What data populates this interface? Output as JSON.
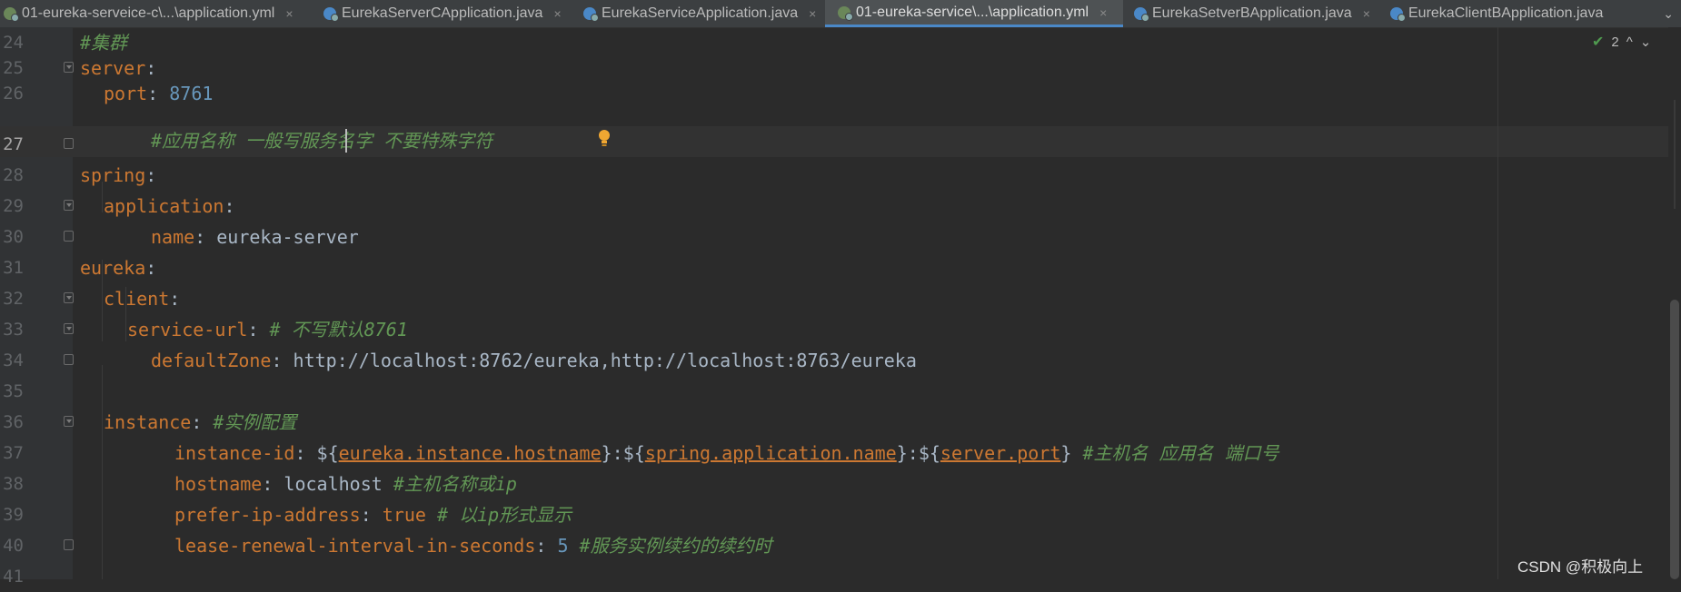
{
  "tabs": [
    {
      "label": "01-eureka-serveice-c\\...\\application.yml",
      "icon": "yml-icon",
      "active": false
    },
    {
      "label": "EurekaServerCApplication.java",
      "icon": "java-class-icon",
      "active": false
    },
    {
      "label": "EurekaServiceApplication.java",
      "icon": "java-class-icon",
      "active": false
    },
    {
      "label": "01-eureka-service\\...\\application.yml",
      "icon": "yml-icon",
      "active": true
    },
    {
      "label": "EurekaSetverBApplication.java",
      "icon": "java-class-icon",
      "active": false
    },
    {
      "label": "EurekaClientBApplication.java",
      "icon": "java-class-icon",
      "active": false
    }
  ],
  "tab_close_glyph": "×",
  "tab_more_glyph": "⌄",
  "inspections": {
    "count": "2",
    "up": "^",
    "down": "⌄"
  },
  "lines": {
    "n24": "24",
    "n25": "25",
    "n26": "26",
    "n27": "27",
    "n28": "28",
    "n29": "29",
    "n30": "30",
    "n31": "31",
    "n32": "32",
    "n33": "33",
    "n34": "34",
    "n35": "35",
    "n36": "36",
    "n37": "37",
    "n38": "38",
    "n39": "39",
    "n40": "40",
    "n41": "41"
  },
  "code": {
    "l24_comment": "#集群",
    "l25_key": "server",
    "l26_key": "port",
    "l26_value": "8761",
    "l27_comment": "#应用名称 一般写服务名字 不要特殊字符",
    "l28_key": "spring",
    "l29_key": "application",
    "l30_key": "name",
    "l30_value": "eureka-server",
    "l31_key": "eureka",
    "l32_key": "client",
    "l33_key": "service-url",
    "l33_comment": "# 不写默认8761",
    "l34_key": "defaultZone",
    "l34_value": "http://localhost:8762/eureka,http://localhost:8763/eureka",
    "l36_key": "instance",
    "l36_comment": "#实例配置",
    "l37_key": "instance-id",
    "l37_ref1": "eureka.instance.hostname",
    "l37_ref2": "spring.application.name",
    "l37_ref3": "server.port",
    "l37_comment": "#主机名 应用名 端口号",
    "l38_key": "hostname",
    "l38_value": "localhost",
    "l38_comment": "#主机名称或ip",
    "l39_key": "prefer-ip-address",
    "l39_value": "true",
    "l39_comment": "# 以ip形式显示",
    "l40_key": "lease-renewal-interval-in-seconds",
    "l40_value": "5",
    "l40_comment": "#服务实例续约的续约时"
  },
  "watermark": "CSDN @积极向上",
  "colors": {
    "background": "#2b2b2b",
    "key": "#cc7832",
    "comment": "#629755",
    "number": "#6897bb",
    "text": "#a9b7c6",
    "active_tab_underline": "#4a88c7"
  }
}
